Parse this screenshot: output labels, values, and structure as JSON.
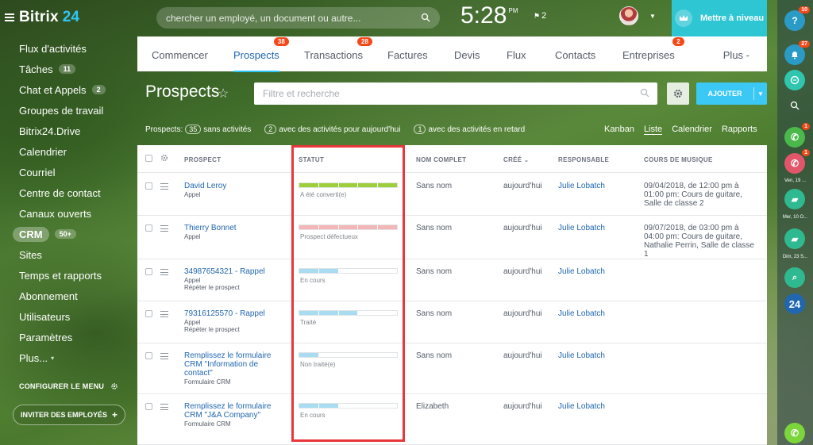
{
  "app": {
    "logo_text": "Bitrix",
    "logo_num": "24"
  },
  "sidebar": {
    "items": [
      {
        "label": "Flux d'activités"
      },
      {
        "label": "Tâches",
        "badge": "11"
      },
      {
        "label": "Chat et Appels",
        "badge": "2"
      },
      {
        "label": "Groupes de travail"
      },
      {
        "label": "Bitrix24.Drive"
      },
      {
        "label": "Calendrier"
      },
      {
        "label": "Courriel"
      },
      {
        "label": "Centre de contact"
      },
      {
        "label": "Canaux ouverts"
      },
      {
        "label": "CRM",
        "badge": "50+"
      },
      {
        "label": "Sites"
      },
      {
        "label": "Temps et rapports"
      },
      {
        "label": "Abonnement"
      },
      {
        "label": "Utilisateurs"
      },
      {
        "label": "Paramètres"
      },
      {
        "label": "Plus..."
      }
    ],
    "configure_label": "CONFIGURER LE MENU",
    "invite_label": "INVITER DES EMPLOYÉS"
  },
  "header": {
    "search_placeholder": "chercher un employé, un document ou autre...",
    "time": "5:28",
    "ampm": "PM",
    "tasks_count": "2",
    "upgrade_label": "Mettre à niveau"
  },
  "tabs": [
    {
      "label": "Commencer"
    },
    {
      "label": "Prospects",
      "count": "38"
    },
    {
      "label": "Transactions",
      "count": "28"
    },
    {
      "label": "Factures"
    },
    {
      "label": "Devis"
    },
    {
      "label": "Flux"
    },
    {
      "label": "Contacts"
    },
    {
      "label": "Entreprises",
      "count": "2"
    }
  ],
  "tab_more": "Plus -",
  "page": {
    "title": "Prospects",
    "filter_placeholder": "Filtre et recherche",
    "add_label": "AJOUTER"
  },
  "counters": {
    "prefix": "Prospects:",
    "no_activity_count": "35",
    "no_activity_label": "sans activités",
    "today_count": "2",
    "today_label": "avec des activités pour aujourd'hui",
    "late_count": "1",
    "late_label": "avec des activités en retard"
  },
  "views": [
    "Kanban",
    "Liste",
    "Calendrier",
    "Rapports"
  ],
  "columns": {
    "prospect": "PROSPECT",
    "status": "STATUT",
    "full_name": "NOM COMPLET",
    "created": "CRÉÉ",
    "responsible": "RESPONSABLE",
    "course": "COURS DE MUSIQUE"
  },
  "rows": [
    {
      "name": "David Leroy",
      "sub1": "Appel",
      "sub2": "",
      "status": "A été converti(e)",
      "full_name": "Sans nom",
      "created": "aujourd'hui",
      "responsible": "Julie Lobatch",
      "course": "09/04/2018, de 12:00 pm à 01:00 pm: Cours de guitare, Salle de classe 2"
    },
    {
      "name": "Thierry Bonnet",
      "sub1": "Appel",
      "sub2": "",
      "status": "Prospect défectueux",
      "full_name": "Sans nom",
      "created": "aujourd'hui",
      "responsible": "Julie Lobatch",
      "course": "09/07/2018, de 03:00 pm à 04:00 pm: Cours de guitare, Nathalie Perrin, Salle de classe 1"
    },
    {
      "name": "34987654321 - Rappel",
      "sub1": "Appel",
      "sub2": "Répéter le prospect",
      "status": "En cours",
      "full_name": "Sans nom",
      "created": "aujourd'hui",
      "responsible": "Julie Lobatch",
      "course": ""
    },
    {
      "name": "79316125570 - Rappel",
      "sub1": "Appel",
      "sub2": "Répéter le prospect",
      "status": "Traité",
      "full_name": "Sans nom",
      "created": "aujourd'hui",
      "responsible": "Julie Lobatch",
      "course": ""
    },
    {
      "name": "Remplissez le formulaire CRM \"Information de contact\"",
      "sub1": "Formulaire CRM",
      "sub2": "",
      "status": "Non traité(e)",
      "full_name": "Sans nom",
      "created": "aujourd'hui",
      "responsible": "Julie Lobatch",
      "course": ""
    },
    {
      "name": "Remplissez le formulaire CRM \"J&A Company\"",
      "sub1": "Formulaire CRM",
      "sub2": "",
      "status": "En cours",
      "full_name": "Elizabeth",
      "created": "aujourd'hui",
      "responsible": "Julie Lobatch",
      "course": ""
    }
  ],
  "right_bar": {
    "help_badge": "10",
    "notif_badge": "27",
    "call1_badge": "1",
    "call2_badge": "1",
    "date1": "Ven, 19 ...",
    "date2": "Mer, 10 O...",
    "date3": "Dim, 23 S...",
    "b24": "24",
    "help_glyph": "?"
  },
  "colors": {
    "accent": "#2fc6f6",
    "link": "#2067b0",
    "converted": "#9dcf3a",
    "defective": "#f4b6b6",
    "in_progress": "#a7dcf1",
    "badge": "#f54819",
    "highlight": "#e8363b"
  }
}
